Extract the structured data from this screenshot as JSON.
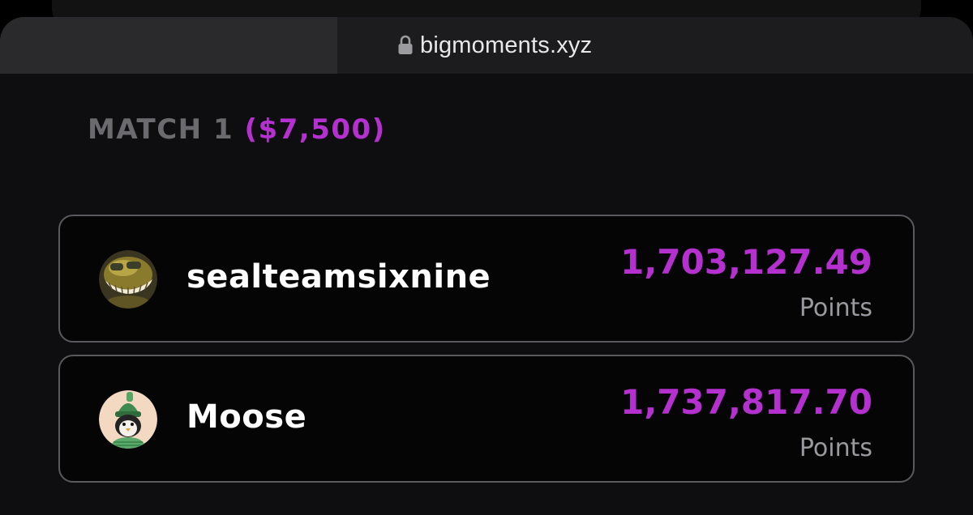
{
  "browser": {
    "url": "bigmoments.xyz",
    "lock_icon": "lock-icon"
  },
  "match": {
    "label": "MATCH 1",
    "prize": "($7,500)",
    "accent_color": "#b430cf"
  },
  "players": [
    {
      "name": "sealteamsixnine",
      "score": "1,703,127.49",
      "points_label": "Points",
      "avatar": "grinning-character-avatar"
    },
    {
      "name": "Moose",
      "score": "1,737,817.70",
      "points_label": "Points",
      "avatar": "penguin-with-green-hat-avatar"
    }
  ]
}
